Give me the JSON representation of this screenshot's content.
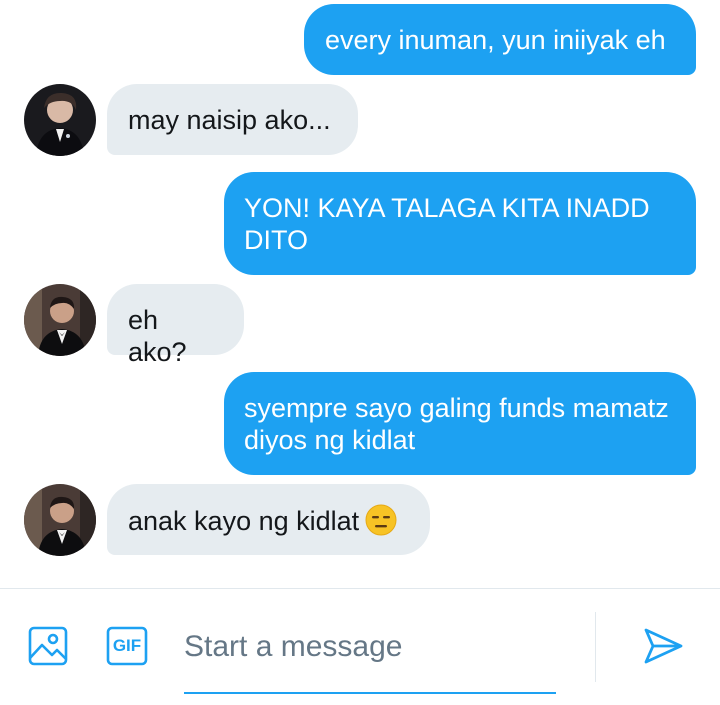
{
  "messages": [
    {
      "direction": "sent",
      "text": "every inuman, yun iniiyak eh"
    },
    {
      "direction": "received",
      "text": "may naisip ako..."
    },
    {
      "direction": "sent",
      "text": "YON! KAYA TALAGA KITA INADD DITO"
    },
    {
      "direction": "received",
      "text": "eh ako?"
    },
    {
      "direction": "sent",
      "text": "syempre sayo galing funds mamatz diyos ng kidlat"
    },
    {
      "direction": "received",
      "text": "anak kayo ng kidlat",
      "emoji": "expressionless-face-emoji"
    }
  ],
  "composer": {
    "placeholder": "Start a message",
    "value": "",
    "gif_label": "GIF",
    "icons": [
      "image-icon",
      "gif-icon",
      "send-icon"
    ]
  },
  "colors": {
    "accent": "#1da1f2",
    "received_bubble": "#e6ecf0",
    "received_text": "#14171a",
    "placeholder": "#657786",
    "divider": "#e1e8ed"
  }
}
